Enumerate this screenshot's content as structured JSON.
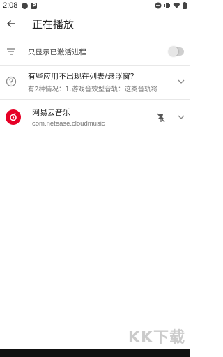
{
  "status_bar": {
    "time": "2:08"
  },
  "app_bar": {
    "title": "正在播放"
  },
  "filter": {
    "label": "只显示已激活进程",
    "toggle_on": false
  },
  "tip": {
    "title": "有些应用不出现在列表/悬浮窗?",
    "subtitle": "有2种情况：1.游戏音效型音轨：这类音轨将"
  },
  "apps": [
    {
      "name": "网易云音乐",
      "package": "com.netease.cloudmusic",
      "icon_color": "#e60026"
    }
  ],
  "watermark": "KK下载"
}
